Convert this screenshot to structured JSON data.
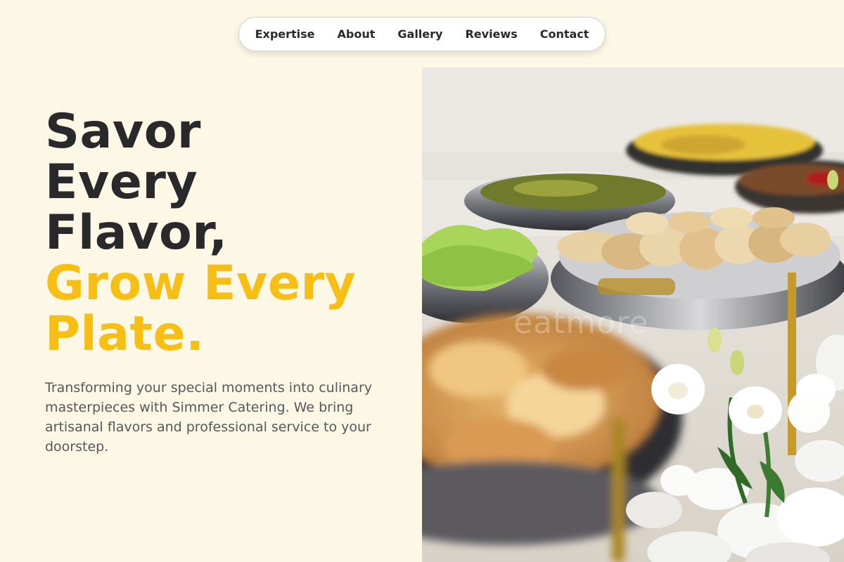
{
  "nav": {
    "items": [
      {
        "label": "Expertise"
      },
      {
        "label": "About"
      },
      {
        "label": "Gallery"
      },
      {
        "label": "Reviews"
      },
      {
        "label": "Contact"
      }
    ]
  },
  "hero": {
    "title_lines": [
      "Savor",
      "Every",
      "Flavor,"
    ],
    "accent_lines": [
      "Grow Every",
      "Plate."
    ],
    "subtitle": "Transforming your special moments into culinary masterpieces with Simmer Catering. We bring artisanal flavors and professional service to your doorstep.",
    "image_watermark": "eatmore"
  },
  "colors": {
    "background": "#fdf8e6",
    "heading": "#29292b",
    "accent": "#f7bf16",
    "body_text": "#55575c"
  },
  "icons": {
    "hero_image": "catering-buffet-photo"
  }
}
